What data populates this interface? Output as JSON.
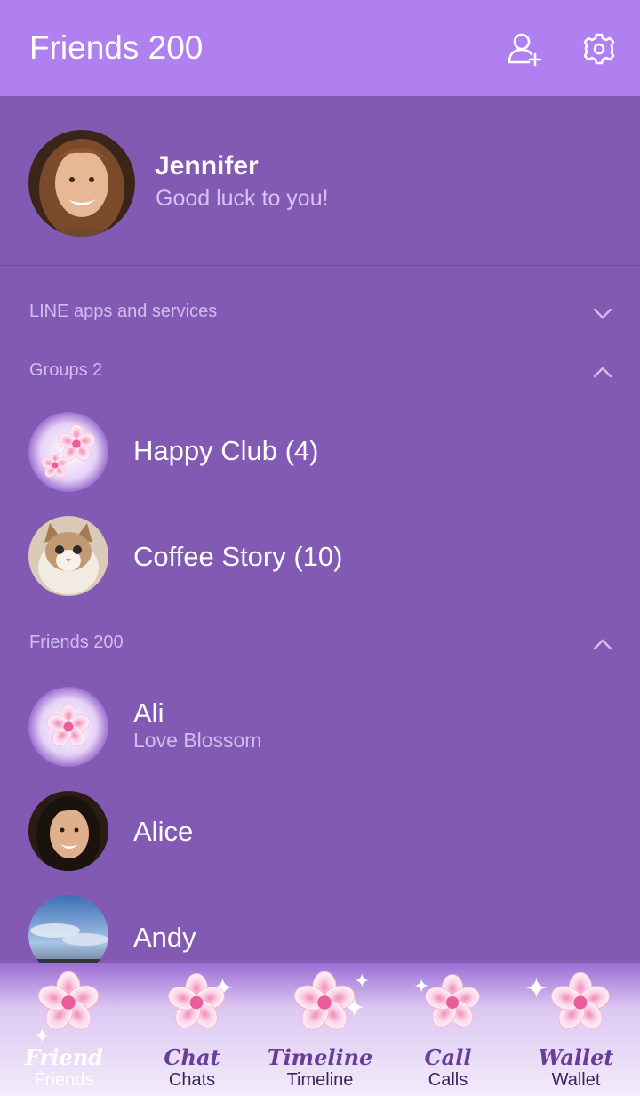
{
  "header": {
    "title": "Friends 200",
    "add_friend_icon": "add-friend-icon",
    "settings_icon": "gear-icon"
  },
  "profile": {
    "name": "Jennifer",
    "status": "Good luck to you!"
  },
  "sections": {
    "apps": {
      "label": "LINE apps and services",
      "expanded": false
    },
    "groups": {
      "label": "Groups 2",
      "expanded": true
    },
    "friends": {
      "label": "Friends 200",
      "expanded": true
    }
  },
  "groups": [
    {
      "name": "Happy Club (4)",
      "avatar": "blossom"
    },
    {
      "name": "Coffee Story (10)",
      "avatar": "cat"
    }
  ],
  "friends": [
    {
      "name": "Ali",
      "status": "Love Blossom",
      "avatar": "blossom"
    },
    {
      "name": "Alice",
      "status": "",
      "avatar": "woman"
    },
    {
      "name": "Andy",
      "status": "",
      "avatar": "sky"
    }
  ],
  "tabs": [
    {
      "script": "Friend",
      "label": "Friends",
      "active": true
    },
    {
      "script": "Chat",
      "label": "Chats",
      "active": false
    },
    {
      "script": "Timeline",
      "label": "Timeline",
      "active": false
    },
    {
      "script": "Call",
      "label": "Calls",
      "active": false
    },
    {
      "script": "Wallet",
      "label": "Wallet",
      "active": false
    }
  ],
  "colors": {
    "header": "#b07ff0",
    "background": "#8259b3",
    "section_text": "#d2bdef"
  }
}
